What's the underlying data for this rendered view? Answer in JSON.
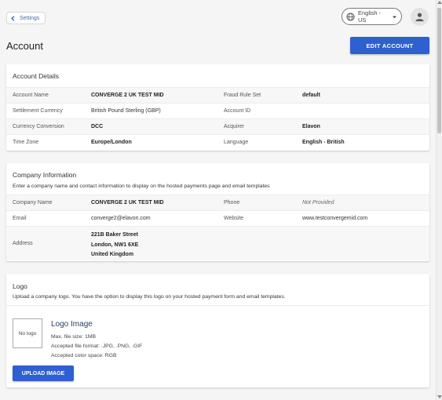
{
  "nav": {
    "back_label": "Settings",
    "language": "English - US"
  },
  "page": {
    "title": "Account",
    "edit_label": "EDIT ACCOUNT"
  },
  "account_details": {
    "title": "Account Details",
    "rows": [
      {
        "l1": "Account Name",
        "v1": "CONVERGE 2 UK TEST MID",
        "l2": "Fraud Rule Set",
        "v2": "default"
      },
      {
        "l1": "Settlement Currency",
        "v1": "British Pound Sterling (GBP)",
        "l2": "Account ID",
        "v2": ""
      },
      {
        "l1": "Currency Conversion",
        "v1": "DCC",
        "l2": "Acquirer",
        "v2": "Elavon"
      },
      {
        "l1": "Time Zone",
        "v1": "Europe/London",
        "l2": "Language",
        "v2": "English - British"
      }
    ]
  },
  "company_info": {
    "title": "Company Information",
    "description": "Enter a company name and contact information to display on the hosted payments page and email templates",
    "rows": [
      {
        "l1": "Company Name",
        "v1": "CONVERGE 2 UK TEST MID",
        "l2": "Phone",
        "v2": "Not Provided"
      },
      {
        "l1": "Email",
        "v1": "converge2@elavon.com",
        "l2": "Website",
        "v2": "www.testconvergemid.com"
      }
    ],
    "address_label": "Address",
    "address_lines": [
      "221B Baker Street",
      "London, NW1 6XE",
      "United Kingdom"
    ]
  },
  "logo": {
    "title": "Logo",
    "description": "Upload a company logo. You have the option to display this logo on your hosted payment form and email templates.",
    "placeholder": "No logo",
    "heading": "Logo Image",
    "specs": [
      "Max. file size: 1MB",
      "Accepted file format: .JPG, .PNG, .GIF",
      "Accepted color space: RGB"
    ],
    "upload_label": "UPLOAD IMAGE"
  },
  "colors": {
    "primary": "#2f5fd0",
    "link": "#4a6ba3"
  }
}
